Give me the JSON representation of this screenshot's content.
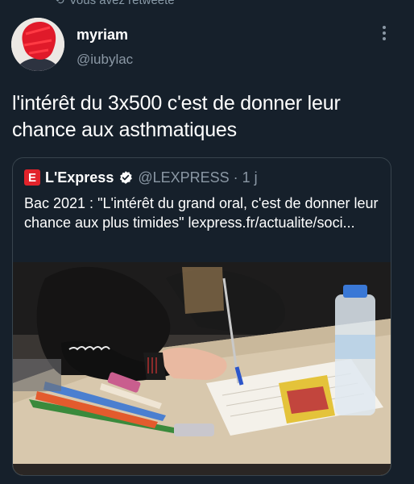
{
  "retweet": {
    "text": "Vous avez retweeté"
  },
  "tweet": {
    "author_name": "myriam",
    "author_handle": "@iubylac",
    "text": "l'intérêt du 3x500 c'est de donner leur chance aux asthmatiques"
  },
  "quote": {
    "logo_letter": "E",
    "author_name": "L'Express",
    "author_handle": "@LEXPRESS · 1 j",
    "text": "Bac 2021 : \"L'intérêt du grand oral, c'est de donner leur chance aux plus timides\" lexpress.fr/actualite/soci..."
  },
  "colors": {
    "background": "#16202b",
    "secondary_text": "#8b98a5",
    "border": "#38444d",
    "express_red": "#e2232b",
    "verified_badge": "#ffffff"
  },
  "icons": [
    "retweet-icon",
    "more-icon",
    "verified-badge-icon",
    "express-logo"
  ]
}
